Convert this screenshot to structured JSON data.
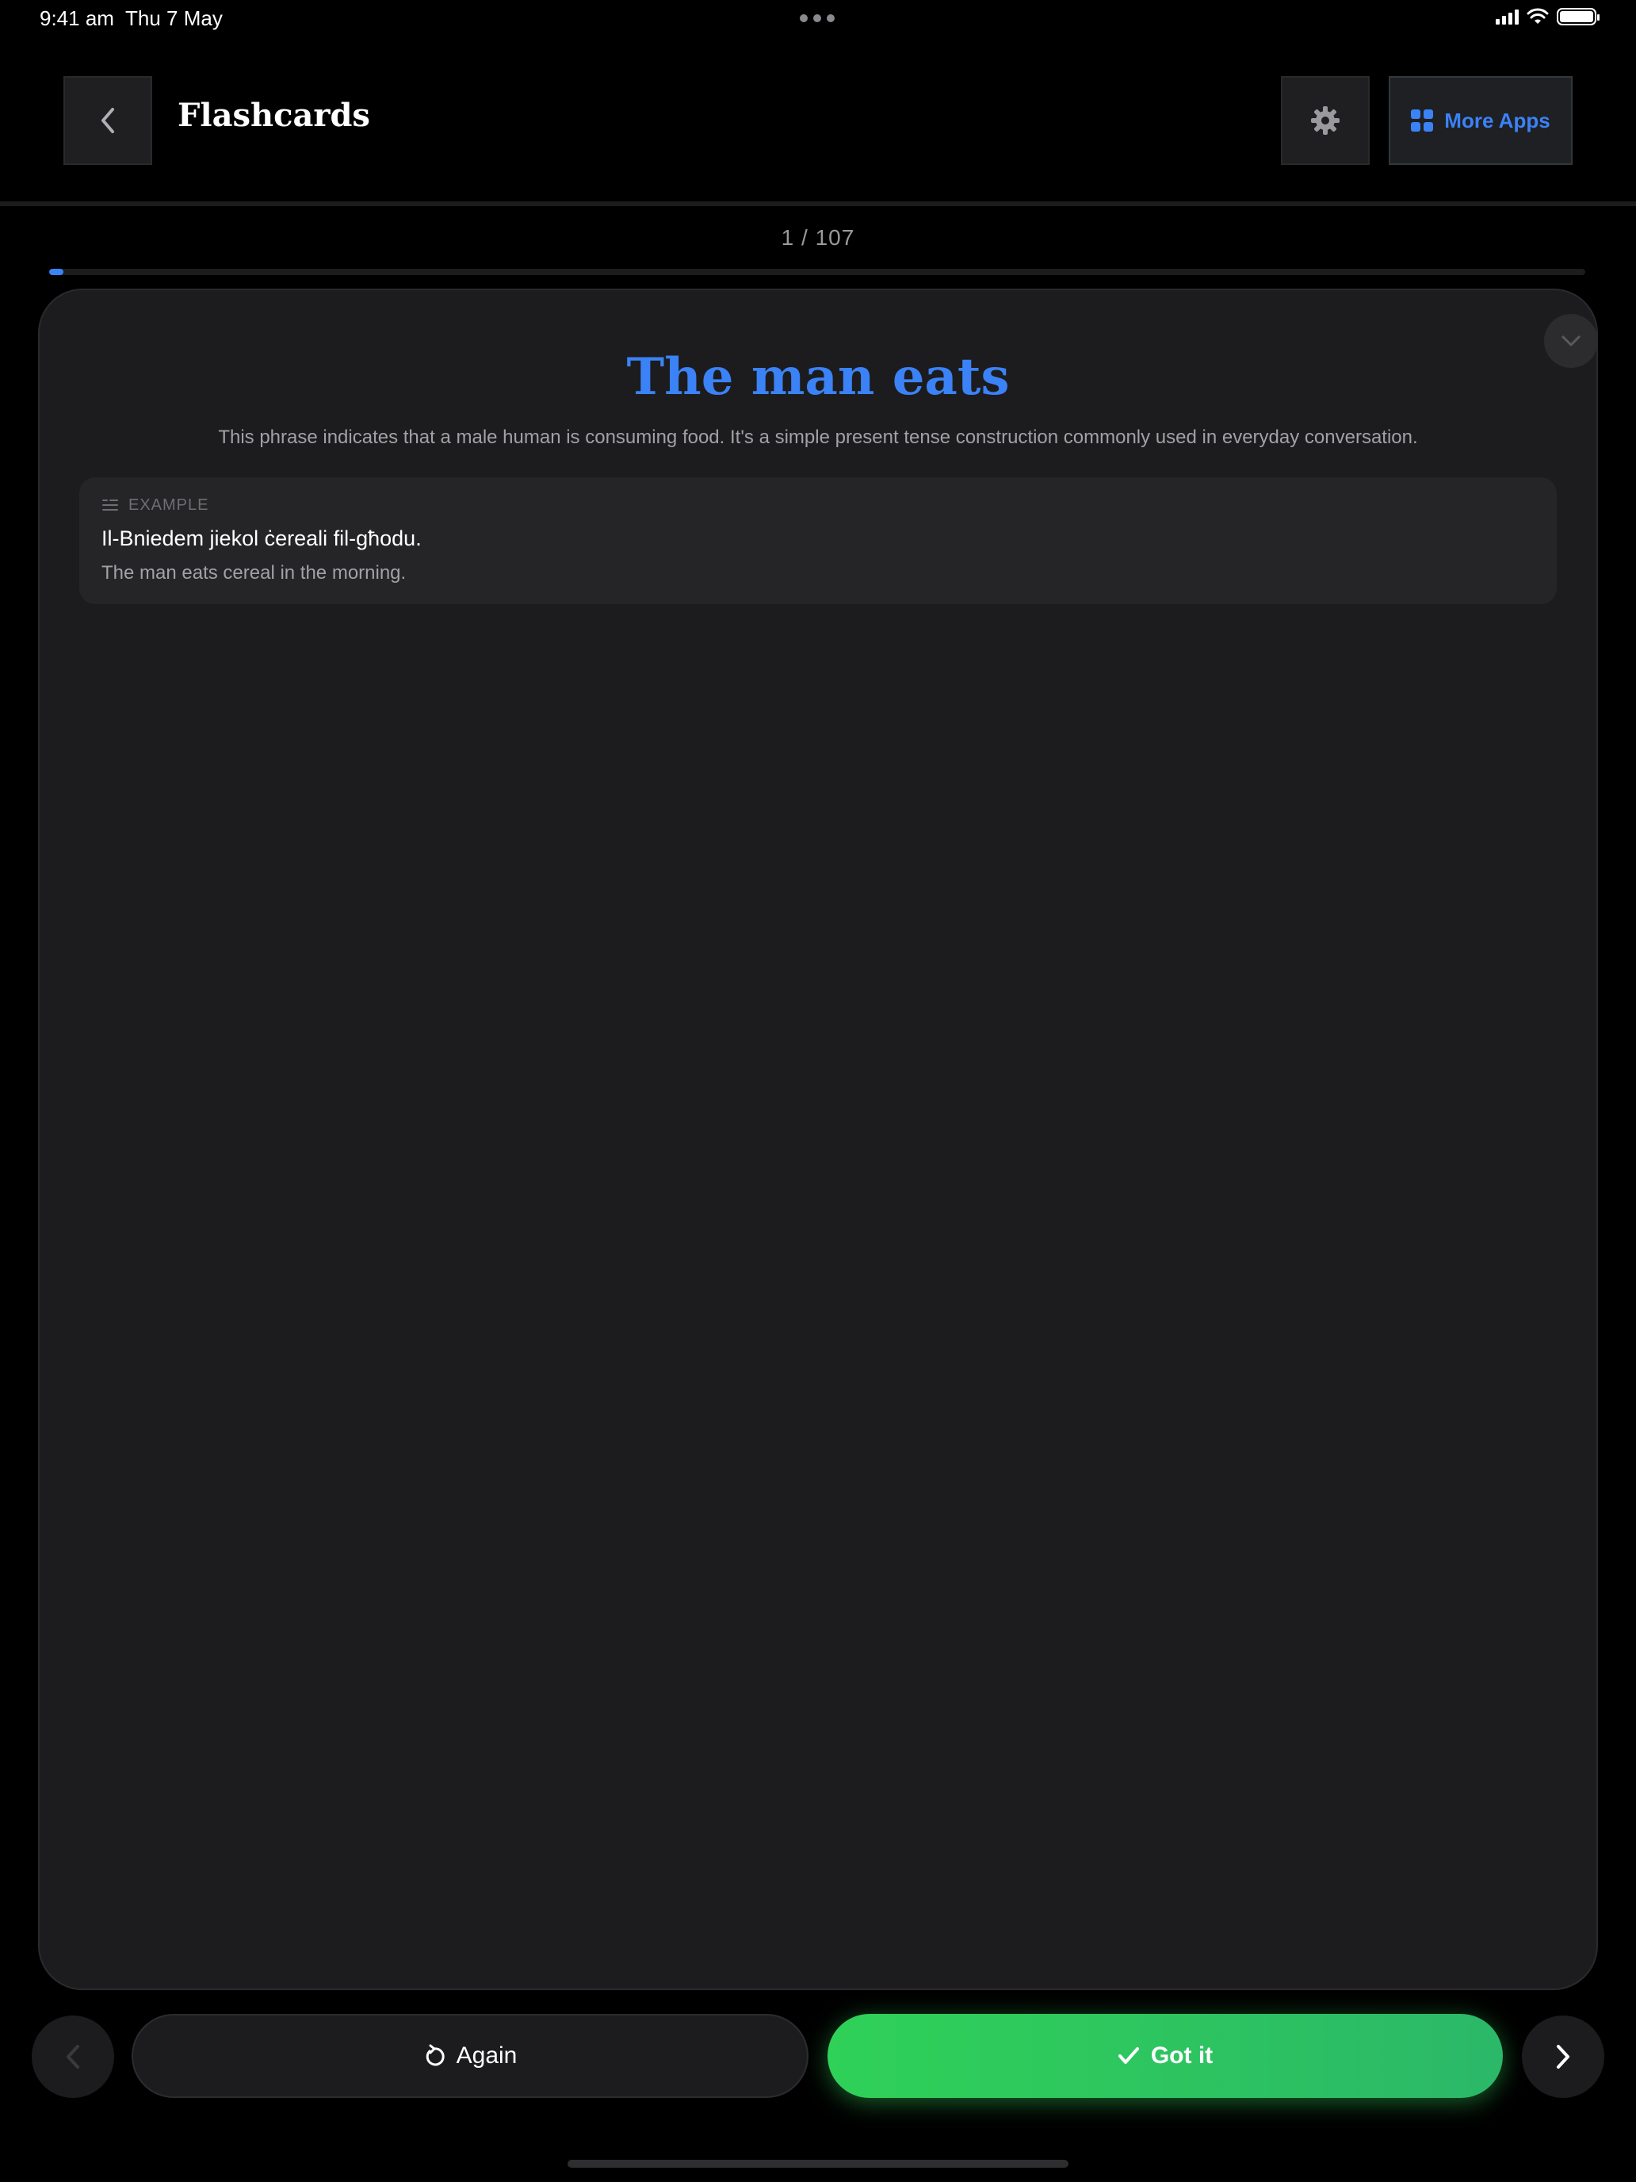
{
  "status_bar": {
    "time": "9:41 am",
    "date": "Thu 7 May"
  },
  "header": {
    "title": "Flashcards",
    "more_apps_label": "More Apps",
    "accent_color": "#3b82f6"
  },
  "progress": {
    "counter": "1 / 107",
    "current": 1,
    "total": 107
  },
  "card": {
    "title": "The man eats",
    "description": "This phrase indicates that a male human is consuming food. It's a simple present tense construction commonly used in everyday conversation.",
    "example": {
      "label": "EXAMPLE",
      "maltese": "Il-Bniedem jiekol ċereali fil-għodu.",
      "english": "The man eats cereal in the morning."
    }
  },
  "controls": {
    "again_label": "Again",
    "got_it_label": "Got it",
    "got_it_color": "#30d158"
  },
  "icons": {
    "back": "chevron-left-icon",
    "settings": "gear-icon",
    "more_apps": "grid-icon",
    "collapse": "chevron-down-icon",
    "example": "text-lines-icon",
    "again": "refresh-icon",
    "got_it": "checkmark-icon",
    "prev": "chevron-left-icon",
    "next": "chevron-right-icon"
  }
}
